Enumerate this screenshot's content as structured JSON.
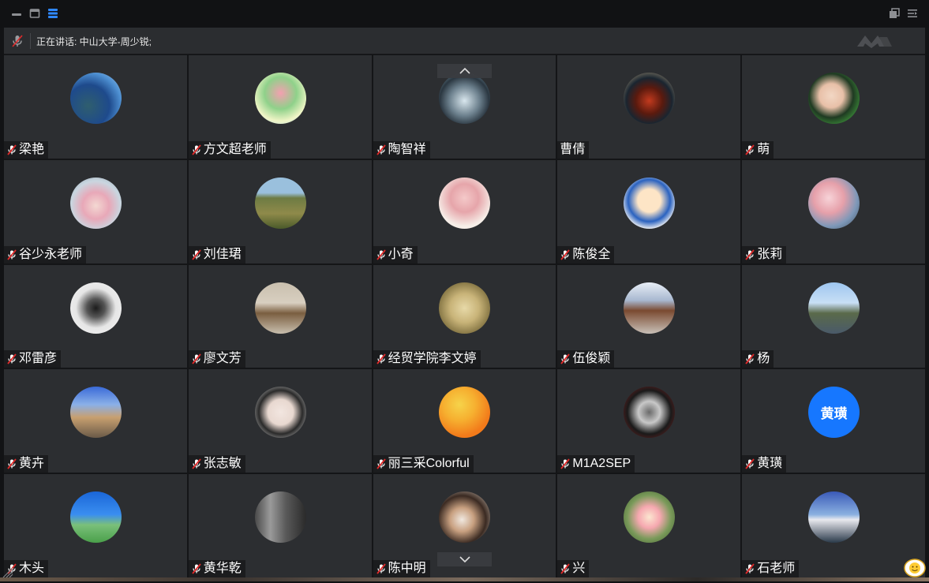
{
  "speaking": {
    "text": "正在讲话: 中山大学-周少锐;"
  },
  "participants": [
    {
      "name": "梁艳",
      "muted": true
    },
    {
      "name": "方文超老师",
      "muted": true
    },
    {
      "name": "陶智祥",
      "muted": true
    },
    {
      "name": "曹倩",
      "muted": false
    },
    {
      "name": "萌",
      "muted": true
    },
    {
      "name": "谷少永老师",
      "muted": true
    },
    {
      "name": "刘佳珺",
      "muted": true
    },
    {
      "name": "小奇",
      "muted": true
    },
    {
      "name": "陈俊全",
      "muted": true
    },
    {
      "name": "张莉",
      "muted": true
    },
    {
      "name": "邓雷彦",
      "muted": true
    },
    {
      "name": "廖文芳",
      "muted": true
    },
    {
      "name": "经贸学院李文婷",
      "muted": true
    },
    {
      "name": "伍俊颖",
      "muted": true
    },
    {
      "name": "杨",
      "muted": true
    },
    {
      "name": "黄卉",
      "muted": true
    },
    {
      "name": "张志敏",
      "muted": true
    },
    {
      "name": "丽三采Colorful",
      "muted": true
    },
    {
      "name": "M1A2SEP",
      "muted": true
    },
    {
      "name": "黄璜",
      "muted": true,
      "avatar_text": "黄璜",
      "avatar_color": "#1677ff"
    },
    {
      "name": "木头",
      "muted": true
    },
    {
      "name": "黄华乾",
      "muted": true
    },
    {
      "name": "陈中明",
      "muted": true
    },
    {
      "name": "兴",
      "muted": true
    },
    {
      "name": "石老师",
      "muted": true
    }
  ],
  "colors": {
    "tile_bg": "#2c2e31",
    "mute_red": "#e02a2a",
    "accent_blue": "#1677ff"
  }
}
